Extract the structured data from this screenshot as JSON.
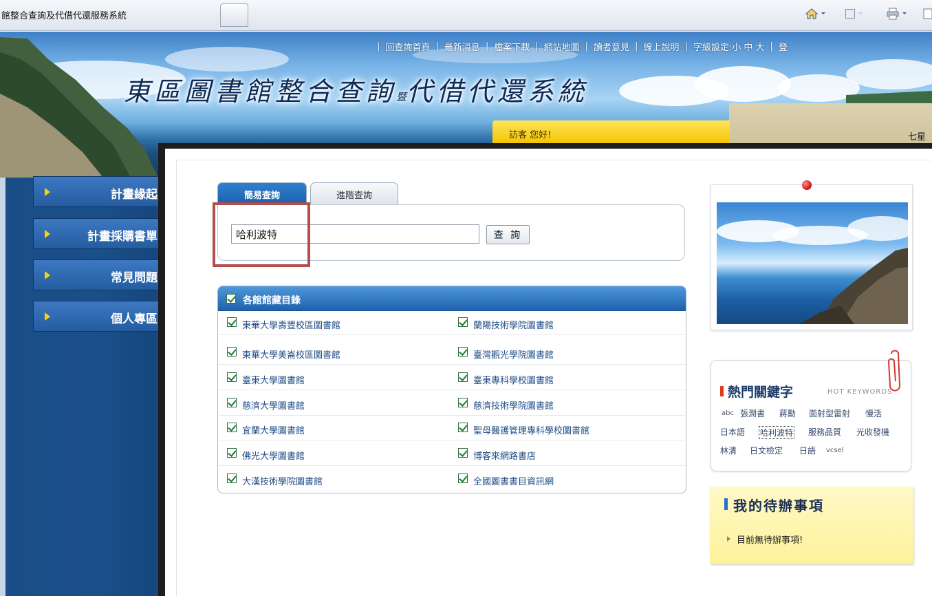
{
  "browser": {
    "tab_title": "館整合查詢及代借代還服務系統"
  },
  "header": {
    "nav_items": [
      "回查詢首頁",
      "最新消息",
      "檔案下載",
      "網站地圖",
      "讀者意見",
      "線上說明",
      "字級設定:小 中 大",
      "登"
    ],
    "title_main_1": "東區圖書館整合查詢",
    "title_small": "暨",
    "title_main_2": "代借代還系統",
    "greeting": "訪客 您好!",
    "banner_label": "七星"
  },
  "sidebar": {
    "items": [
      {
        "label": "計畫緣起"
      },
      {
        "label": "計畫採購書單"
      },
      {
        "label": "常見問題"
      },
      {
        "label": "個人專區"
      }
    ]
  },
  "search": {
    "tabs": [
      {
        "label": "簡易查詢",
        "active": true
      },
      {
        "label": "進階查詢",
        "active": false
      }
    ],
    "query": "哈利波特",
    "button_label": "查 詢"
  },
  "libraries": {
    "header": "各館館藏目錄",
    "items": [
      "東華大學壽豐校區圖書館",
      "蘭陽技術學院圖書館",
      "東華大學美崙校區圖書館",
      "臺灣觀光學院圖書館",
      "臺東大學圖書館",
      "臺東專科學校圖書館",
      "慈濟大學圖書館",
      "慈濟技術學院圖書館",
      "宜蘭大學圖書館",
      "聖母醫護管理專科學校圖書館",
      "佛光大學圖書館",
      "博客來網路書店",
      "大漢技術學院圖書館",
      "全國圖書書目資訊網"
    ]
  },
  "hot_keywords": {
    "title": "熱門關鍵字",
    "subtitle": "HOT KEYWORDS",
    "words": [
      "abc",
      "張潤書",
      "蔣勳",
      "面射型雷射",
      "慢活",
      "日本語",
      "哈利波特",
      "服務品質",
      "光收發機",
      "林清",
      "日文檢定",
      "日語",
      "vcsel"
    ]
  },
  "todo": {
    "title": "我的待辦事項",
    "message": "目前無待辦事項!"
  },
  "colors": {
    "nav_blue": "#1b4f89",
    "tab_active": "#1c5fa8",
    "greeting_yellow": "#f3c500",
    "highlight_red": "#b44d4d",
    "todo_yellow": "#fdf29a"
  }
}
